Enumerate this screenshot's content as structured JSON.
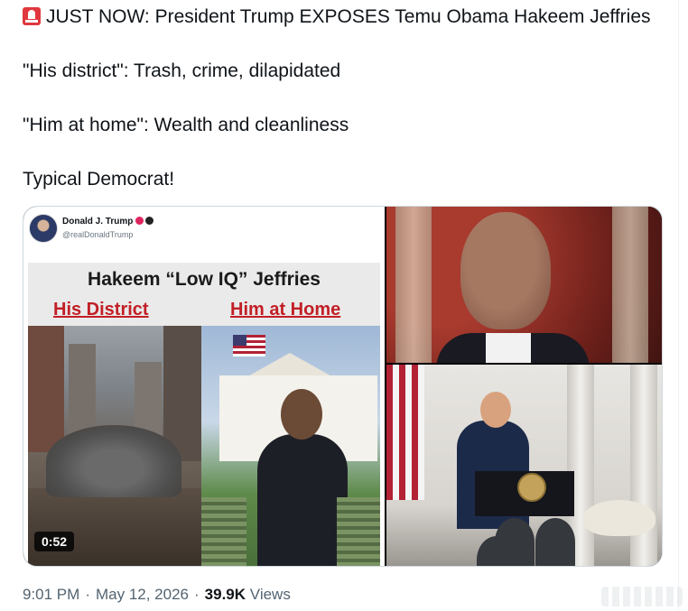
{
  "tweet": {
    "lines": [
      "JUST NOW: President Trump EXPOSES Temu Obama Hakeem Jeffries",
      "\"His district\": Trash, crime, dilapidated",
      "\"Him at home\": Wealth and cleanliness",
      "Typical Democrat!"
    ],
    "emoji_icon": "siren-icon"
  },
  "media": {
    "embedded_post": {
      "name": "Donald J. Trump",
      "handle": "@realDonaldTrump"
    },
    "card": {
      "title": "Hakeem “Low IQ” Jeffries",
      "left_label": "His District",
      "right_label": "Him at Home"
    },
    "video_duration": "0:52"
  },
  "meta": {
    "time": "9:01 PM",
    "date": "May 12, 2026",
    "views_count": "39.9K",
    "views_label": "Views"
  },
  "colors": {
    "text": "#0f1419",
    "muted": "#536471",
    "accent_red": "#c21f26",
    "siren": "#e0383e"
  }
}
